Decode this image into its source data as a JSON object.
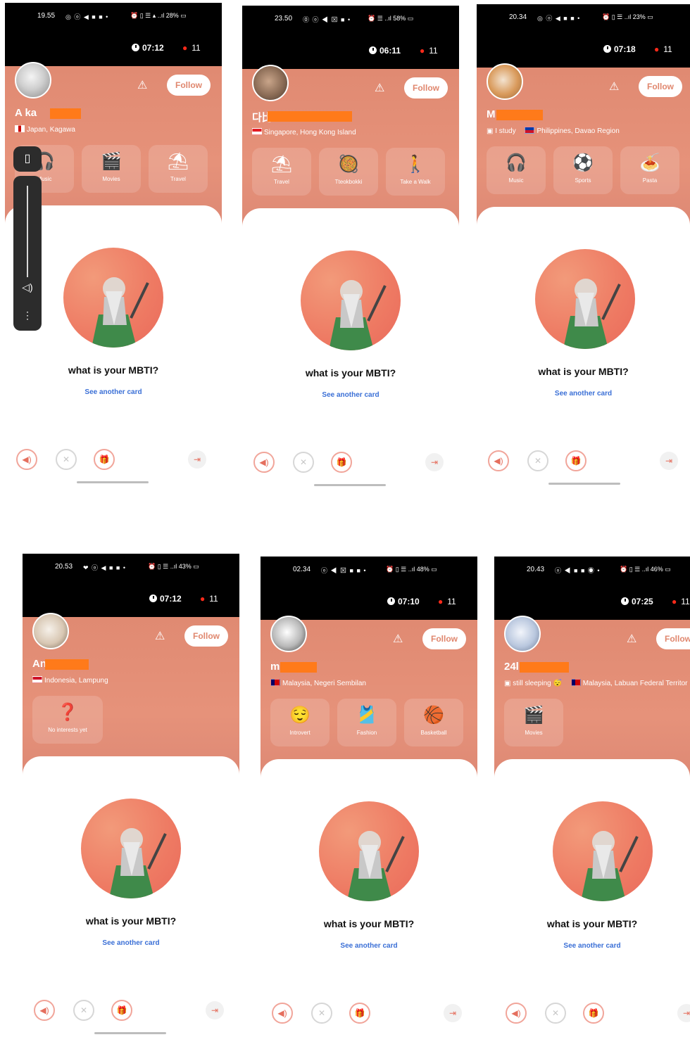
{
  "screens": [
    {
      "status": {
        "time": "19.55",
        "left_icons": "◎ ⓞ ◀ ■ ■  •",
        "right_icons": "⏰ ▯ ☰ ▴ ..ıl 28% ▭"
      },
      "timer": "07:12",
      "pins": "11",
      "user": {
        "name": "A  ka",
        "location": "Japan, Kagawa",
        "extra": "",
        "flag_colors": [
          "#ffffff",
          "#cc0000"
        ]
      },
      "follow": "Follow",
      "chips": [
        {
          "icon": "🎧",
          "label": "Music"
        },
        {
          "icon": "🎬",
          "label": "Movies"
        },
        {
          "icon": "⛱",
          "label": "Travel"
        }
      ],
      "card": {
        "question": "what is your MBTI?",
        "another": "See another card"
      }
    },
    {
      "status": {
        "time": "23.50",
        "left_icons": "⓪ ⓞ ◀ ⊠ ■  •",
        "right_icons": "⏰ ☰ ..ıl 58% ▭"
      },
      "timer": "06:11",
      "pins": "11",
      "user": {
        "name": "다比",
        "location": "Singapore, Hong Kong Island",
        "extra": "",
        "flag_colors": [
          "#e31b23",
          "#ffffff"
        ]
      },
      "follow": "Follow",
      "chips": [
        {
          "icon": "⛱",
          "label": "Travel"
        },
        {
          "icon": "🥘",
          "label": "Tteokbokki"
        },
        {
          "icon": "🚶",
          "label": "Take a Walk"
        }
      ],
      "card": {
        "question": "what is your MBTI?",
        "another": "See another card"
      }
    },
    {
      "status": {
        "time": "20.34",
        "left_icons": "◎ ⓞ ◀ ■ ■  •",
        "right_icons": "⏰ ▯ ☰ ..ıl 23% ▭"
      },
      "timer": "07:18",
      "pins": "11",
      "user": {
        "name": "M",
        "location": "Philippines, Davao Region",
        "extra": "I study",
        "flag_colors": [
          "#0038a8",
          "#ce1126"
        ]
      },
      "follow": "Follow",
      "chips": [
        {
          "icon": "🎧",
          "label": "Music"
        },
        {
          "icon": "⚽",
          "label": "Sports"
        },
        {
          "icon": "🍝",
          "label": "Pasta"
        }
      ],
      "card": {
        "question": "what is your MBTI?",
        "another": "See another card"
      }
    },
    {
      "status": {
        "time": "20.53",
        "left_icons": "❤ ⓞ ◀ ■ ■  •",
        "right_icons": "⏰ ▯ ☰ ..ıl 43% ▭"
      },
      "timer": "07:12",
      "pins": "11",
      "user": {
        "name": "An",
        "location": "Indonesia, Lampung",
        "extra": "",
        "flag_colors": [
          "#ce1126",
          "#ffffff"
        ]
      },
      "follow": "Follow",
      "chips": [
        {
          "icon": "❓",
          "label": "No interests yet"
        }
      ],
      "card": {
        "question": "what is your MBTI?",
        "another": "See another card"
      }
    },
    {
      "status": {
        "time": "02.34",
        "left_icons": "ⓞ ◀ ⊠ ■ ■  •",
        "right_icons": "⏰ ▯ ☰ ..ıl 48% ▭"
      },
      "timer": "07:10",
      "pins": "11",
      "user": {
        "name": "m",
        "location": "Malaysia, Negeri Sembilan",
        "extra": "",
        "flag_colors": [
          "#cc0001",
          "#010066"
        ]
      },
      "follow": "Follow",
      "chips": [
        {
          "icon": "😌",
          "label": "Introvert"
        },
        {
          "icon": "🎽",
          "label": "Fashion"
        },
        {
          "icon": "🏀",
          "label": "Basketball"
        }
      ],
      "card": {
        "question": "what is your MBTI?",
        "another": "See another card"
      }
    },
    {
      "status": {
        "time": "20.43",
        "left_icons": "ⓞ ◀ ■ ■ ◉  •",
        "right_icons": "⏰ ▯ ☰ ..ıl 46% ▭"
      },
      "timer": "07:25",
      "pins": "11",
      "user": {
        "name": "24l",
        "location": "Malaysia, Labuan Federal Territor",
        "extra": "still sleeping 😴",
        "flag_colors": [
          "#cc0001",
          "#010066"
        ]
      },
      "follow": "Follow",
      "chips": [
        {
          "icon": "🎬",
          "label": "Movies"
        }
      ],
      "card": {
        "question": "what is your MBTI?",
        "another": "See another card"
      }
    }
  ],
  "icons": {
    "warning": "warning-icon",
    "speaker": "speaker-icon",
    "mute": "mute-icon",
    "gift": "gift-icon",
    "exit": "exit-icon"
  },
  "volume_overlay": {
    "top_icon": "vibrate-icon",
    "speaker_icon": "volume-icon",
    "more_icon": "more-icon"
  }
}
